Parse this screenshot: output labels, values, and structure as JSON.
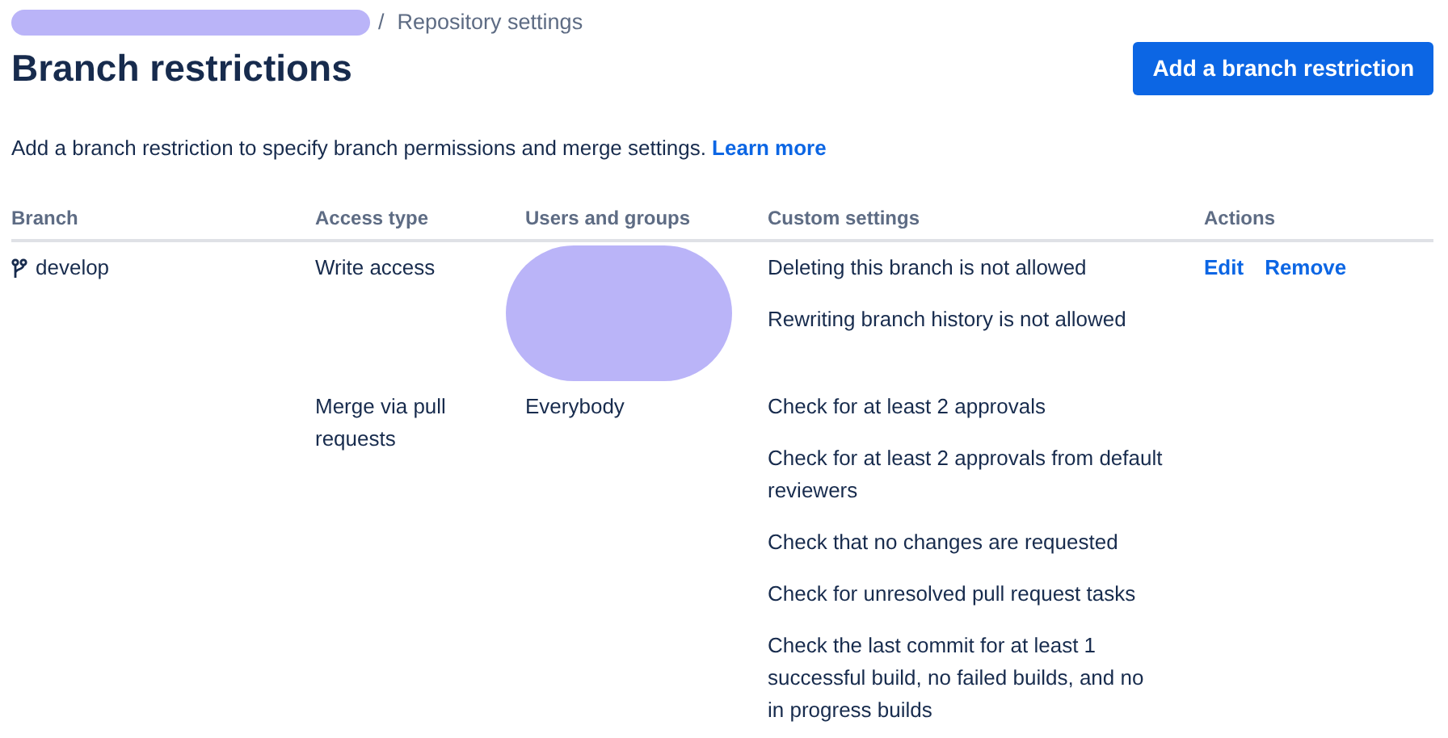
{
  "breadcrumb": {
    "redacted": true,
    "separator": "/",
    "current": "Repository settings"
  },
  "title": "Branch restrictions",
  "primary_button": "Add a branch restriction",
  "description": "Add a branch restriction to specify branch permissions and merge settings.",
  "description_link": "Learn more",
  "table": {
    "columns": [
      "Branch",
      "Access type",
      "Users and groups",
      "Custom settings",
      "Actions"
    ],
    "rows": [
      {
        "branch": "develop",
        "actions": [
          "Edit",
          "Remove"
        ],
        "restrictions": [
          {
            "access_type": "Write access",
            "users_redacted": true,
            "settings": [
              "Deleting this branch is not allowed",
              "Rewriting branch history is not allowed"
            ]
          },
          {
            "access_type": "Merge via pull requests",
            "users": "Everybody",
            "settings": [
              "Check for at least 2 approvals",
              "Check for at least 2 approvals from default reviewers",
              "Check that no changes are requested",
              "Check for unresolved pull request tasks",
              "Check the last commit for at least 1 successful build, no failed builds, and no in progress builds"
            ]
          }
        ]
      }
    ]
  }
}
